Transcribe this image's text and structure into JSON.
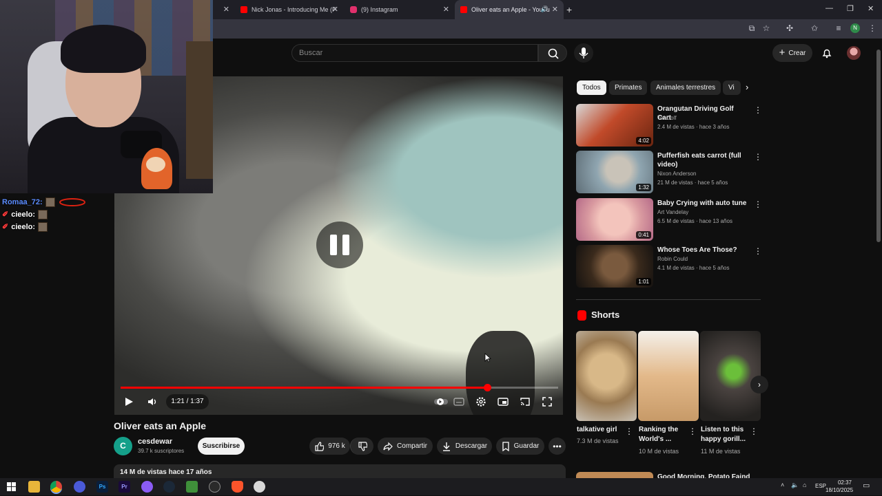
{
  "browser": {
    "tabs": [
      {
        "title": "Nick Jonas - Introducing Me (F",
        "color": "#ff0000"
      },
      {
        "title": "(9) Instagram",
        "color": "#e1306c"
      },
      {
        "title": "Oliver eats an Apple - YouTu",
        "color": "#ff0000"
      }
    ],
    "new_tab_icon": "plus-icon",
    "profile_initial": "N"
  },
  "youtube": {
    "search_placeholder": "Buscar",
    "create_label": "Crear"
  },
  "player": {
    "time": "1:21 / 1:37",
    "progress_fraction": 0.838,
    "state": "paused-overlay"
  },
  "video": {
    "title": "Oliver eats an Apple",
    "channel_initial": "C",
    "channel_name": "cesdewar",
    "subscribers": "39.7 k suscriptores",
    "subscribe_label": "Suscribirse",
    "likes": "976 k",
    "share_label": "Compartir",
    "download_label": "Descargar",
    "save_label": "Guardar",
    "views_date": "14 M de vistas  hace 17 años"
  },
  "chat": [
    {
      "user": "Romaa_72:",
      "color": "#5b8cff"
    },
    {
      "user": "cieelo:",
      "color": "#ff5a5a"
    },
    {
      "user": "cieelo:",
      "color": "#ff5a5a"
    }
  ],
  "chips": [
    "Todos",
    "Primates",
    "Animales terrestres",
    "Vi"
  ],
  "recommendations": [
    {
      "title": "Orangutan Driving Golf Cart",
      "channel": "TenGolf",
      "meta": "2.4 M de vistas · hace 3 años",
      "duration": "4:02"
    },
    {
      "title": "Pufferfish eats carrot (full video)",
      "channel": "Nixon Anderson",
      "meta": "21 M de vistas · hace 5 años",
      "duration": "1:32"
    },
    {
      "title": "Baby Crying with auto tune",
      "channel": "Art Vandelay",
      "meta": "6.5 M de vistas · hace 13 años",
      "duration": "0:41"
    },
    {
      "title": "Whose Toes Are Those?",
      "channel": "Robin Could",
      "meta": "4.1 M de vistas · hace 5 años",
      "duration": "1:01"
    }
  ],
  "shorts": {
    "heading": "Shorts",
    "items": [
      {
        "title": "talkative girl",
        "views": "7.3 M de vistas"
      },
      {
        "title": "Ranking the World's ...",
        "views": "10 M de vistas"
      },
      {
        "title": "Listen to this happy gorill...",
        "views": "11 M de vistas"
      }
    ]
  },
  "next_recommendation_title": "Good Morning, Potato Faind",
  "taskbar": {
    "lang": "ESP",
    "time": "02:37",
    "date": "18/10/2025"
  }
}
